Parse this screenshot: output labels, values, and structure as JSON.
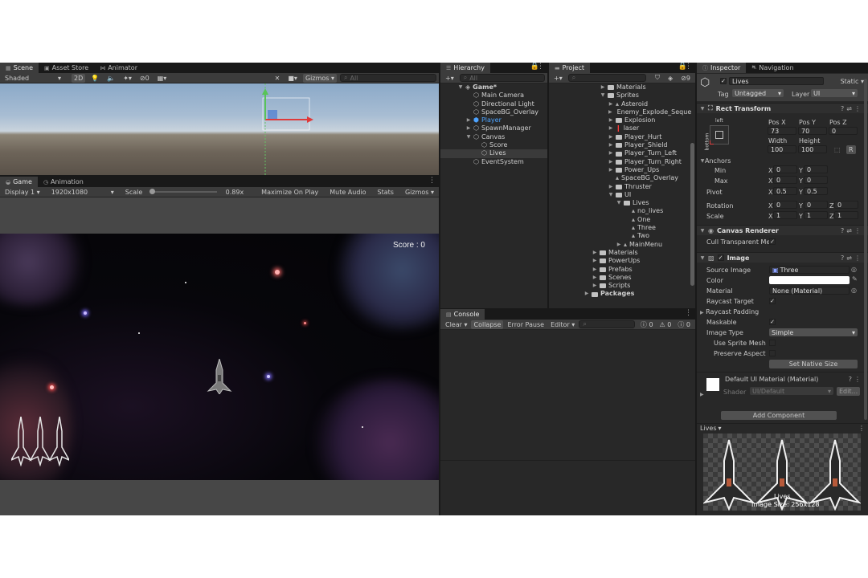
{
  "scene": {
    "tabs": [
      "Scene",
      "Asset Store",
      "Animator"
    ],
    "shading": "Shaded",
    "mode_2d": "2D",
    "hidden_count": "0",
    "gizmos": "Gizmos",
    "search_placeholder": "All"
  },
  "game": {
    "tabs": [
      "Game",
      "Animation"
    ],
    "display": "Display 1",
    "resolution": "1920x1080",
    "scale_label": "Scale",
    "scale_value": "0.89x",
    "buttons": [
      "Maximize On Play",
      "Mute Audio",
      "Stats",
      "Gizmos"
    ],
    "score_text": "Score : 0"
  },
  "hierarchy": {
    "tab": "Hierarchy",
    "search_placeholder": "All",
    "items": [
      {
        "label": "Game*",
        "indent": 0,
        "arrow": "▼",
        "icon": "unity-scene-icon"
      },
      {
        "label": "Main Camera",
        "indent": 1,
        "arrow": "",
        "icon": "cube-icon"
      },
      {
        "label": "Directional Light",
        "indent": 1,
        "arrow": "",
        "icon": "cube-icon"
      },
      {
        "label": "SpaceBG_Overlay",
        "indent": 1,
        "arrow": "",
        "icon": "cube-icon"
      },
      {
        "label": "Player",
        "indent": 1,
        "arrow": "▶",
        "icon": "prefab-icon",
        "color": "#4da3ff"
      },
      {
        "label": "SpawnManager",
        "indent": 1,
        "arrow": "▶",
        "icon": "cube-icon"
      },
      {
        "label": "Canvas",
        "indent": 1,
        "arrow": "▼",
        "icon": "cube-icon"
      },
      {
        "label": "Score",
        "indent": 2,
        "arrow": "",
        "icon": "cube-icon"
      },
      {
        "label": "Lives",
        "indent": 2,
        "arrow": "",
        "icon": "cube-icon",
        "selected": true
      },
      {
        "label": "EventSystem",
        "indent": 1,
        "arrow": "",
        "icon": "cube-icon"
      }
    ]
  },
  "project": {
    "tab": "Project",
    "hidden_count": "9",
    "items": [
      {
        "label": "Materials",
        "indent": 0,
        "arrow": "▶",
        "icon": "folder-icon"
      },
      {
        "label": "Sprites",
        "indent": 0,
        "arrow": "▼",
        "icon": "folder-icon"
      },
      {
        "label": "Asteroid",
        "indent": 1,
        "arrow": "▶",
        "icon": "sprite-icon"
      },
      {
        "label": "Enemy_Explode_Seque",
        "indent": 1,
        "arrow": "▶",
        "icon": "folder-icon"
      },
      {
        "label": "Explosion",
        "indent": 1,
        "arrow": "▶",
        "icon": "folder-icon"
      },
      {
        "label": "laser",
        "indent": 1,
        "arrow": "▶",
        "icon": "laser-icon"
      },
      {
        "label": "Player_Hurt",
        "indent": 1,
        "arrow": "▶",
        "icon": "folder-icon"
      },
      {
        "label": "Player_Shield",
        "indent": 1,
        "arrow": "▶",
        "icon": "folder-icon"
      },
      {
        "label": "Player_Turn_Left",
        "indent": 1,
        "arrow": "▶",
        "icon": "folder-icon"
      },
      {
        "label": "Player_Turn_Right",
        "indent": 1,
        "arrow": "▶",
        "icon": "folder-icon"
      },
      {
        "label": "Power_Ups",
        "indent": 1,
        "arrow": "▶",
        "icon": "folder-icon"
      },
      {
        "label": "SpaceBG_Overlay",
        "indent": 1,
        "arrow": "",
        "icon": "sprite-icon"
      },
      {
        "label": "Thruster",
        "indent": 1,
        "arrow": "▶",
        "icon": "folder-icon"
      },
      {
        "label": "UI",
        "indent": 1,
        "arrow": "▼",
        "icon": "folder-icon"
      },
      {
        "label": "Lives",
        "indent": 2,
        "arrow": "▼",
        "icon": "folder-icon"
      },
      {
        "label": "no_lives",
        "indent": 3,
        "arrow": "",
        "icon": "sprite-icon"
      },
      {
        "label": "One",
        "indent": 3,
        "arrow": "",
        "icon": "sprite-icon"
      },
      {
        "label": "Three",
        "indent": 3,
        "arrow": "",
        "icon": "sprite-icon"
      },
      {
        "label": "Two",
        "indent": 3,
        "arrow": "",
        "icon": "sprite-icon"
      },
      {
        "label": "MainMenu",
        "indent": 2,
        "arrow": "▶",
        "icon": "sprite-icon"
      },
      {
        "label": "Materials",
        "indent": -1,
        "arrow": "▶",
        "icon": "folder-icon"
      },
      {
        "label": "PowerUps",
        "indent": -1,
        "arrow": "▶",
        "icon": "folder-icon"
      },
      {
        "label": "Prefabs",
        "indent": -1,
        "arrow": "▶",
        "icon": "folder-icon"
      },
      {
        "label": "Scenes",
        "indent": -1,
        "arrow": "▶",
        "icon": "folder-icon"
      },
      {
        "label": "Scripts",
        "indent": -1,
        "arrow": "▶",
        "icon": "folder-icon"
      },
      {
        "label": "Packages",
        "indent": -2,
        "arrow": "▶",
        "icon": "folder-icon",
        "bold": true
      }
    ]
  },
  "console": {
    "tab": "Console",
    "clear": "Clear",
    "collapse": "Collapse",
    "error_pause": "Error Pause",
    "editor": "Editor",
    "info_count": "0",
    "warn_count": "0",
    "error_count": "0"
  },
  "inspector": {
    "tabs": [
      "Inspector",
      "Navigation"
    ],
    "object_name": "Lives",
    "static_label": "Static",
    "tag_label": "Tag",
    "tag_value": "Untagged",
    "layer_label": "Layer",
    "layer_value": "UI",
    "rect_transform": {
      "title": "Rect Transform",
      "anchor_h": "left",
      "anchor_v": "bottom",
      "posx_label": "Pos X",
      "posx": "73",
      "posy_label": "Pos Y",
      "posy": "70",
      "posz_label": "Pos Z",
      "posz": "0",
      "width_label": "Width",
      "width": "100",
      "height_label": "Height",
      "height": "100",
      "r_button": "R",
      "anchors_label": "Anchors",
      "min_label": "Min",
      "min_x": "0",
      "min_y": "0",
      "max_label": "Max",
      "max_x": "0",
      "max_y": "0",
      "pivot_label": "Pivot",
      "pivot_x": "0.5",
      "pivot_y": "0.5",
      "rotation_label": "Rotation",
      "rot_x": "0",
      "rot_y": "0",
      "rot_z": "0",
      "scale_label": "Scale",
      "scale_x": "1",
      "scale_y": "1",
      "scale_z": "1"
    },
    "canvas_renderer": {
      "title": "Canvas Renderer",
      "cull_label": "Cull Transparent Mes"
    },
    "image": {
      "title": "Image",
      "source_label": "Source Image",
      "source_value": "Three",
      "color_label": "Color",
      "material_label": "Material",
      "material_value": "None (Material)",
      "raycast_target_label": "Raycast Target",
      "raycast_padding_label": "Raycast Padding",
      "maskable_label": "Maskable",
      "image_type_label": "Image Type",
      "image_type_value": "Simple",
      "use_sprite_mesh_label": "Use Sprite Mesh",
      "preserve_aspect_label": "Preserve Aspect",
      "native_size_button": "Set Native Size"
    },
    "material": {
      "title": "Default UI Material (Material)",
      "shader_label": "Shader",
      "shader_value": "UI/Default",
      "edit_button": "Edit..."
    },
    "add_component": "Add Component",
    "preview_title": "Lives",
    "preview_caption_1": "Lives",
    "preview_caption_2": "Image Size: 256x128"
  }
}
